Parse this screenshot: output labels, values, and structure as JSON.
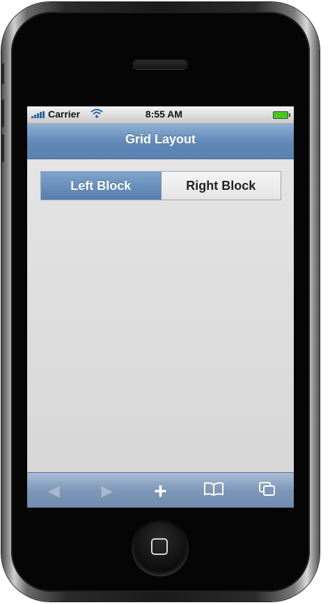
{
  "status_bar": {
    "carrier": "Carrier",
    "time": "8:55 AM"
  },
  "nav_bar": {
    "title": "Grid Layout"
  },
  "grid": {
    "left_block": "Left Block",
    "right_block": "Right Block"
  },
  "toolbar": {
    "back_icon": "◀",
    "forward_icon": "▶",
    "add_icon": "+",
    "bookmarks_icon": "book-icon",
    "pages_icon": "pages-icon"
  },
  "colors": {
    "nav_blue": "#6a90bd",
    "selected_block": "#6a90bd",
    "battery_green": "#47c91b"
  }
}
